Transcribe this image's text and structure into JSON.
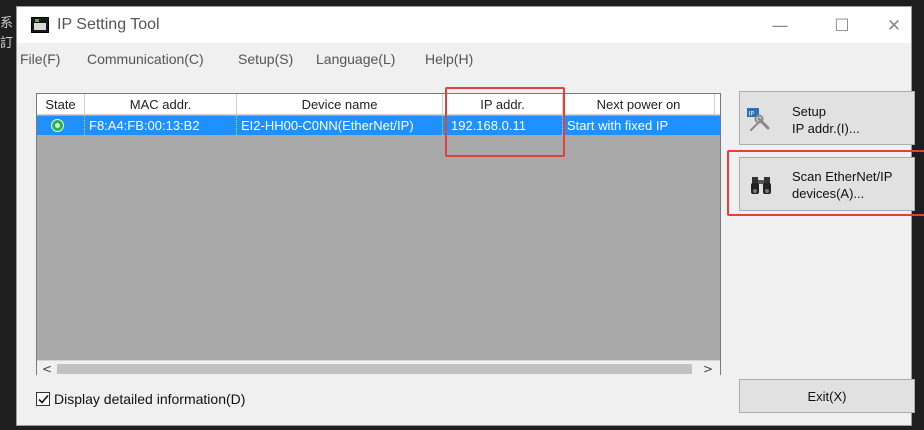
{
  "desktop": {
    "glyph_top": "系",
    "glyph_bottom": "訂"
  },
  "window": {
    "title": "IP Setting Tool",
    "controls": {
      "minimize": "—",
      "maximize": "☐",
      "close": "✕"
    }
  },
  "menu": [
    "File(F)",
    "Communication(C)",
    "Setup(S)",
    "Language(L)",
    "Help(H)"
  ],
  "device_list": {
    "columns": [
      "State",
      "MAC addr.",
      "Device name",
      "IP addr.",
      "Next power on"
    ],
    "rows": [
      {
        "state": "online",
        "mac": "F8:A4:FB:00:13:B2",
        "device_name": "EI2-HH00-C0NN(EtherNet/IP)",
        "ip": "192.168.0.11",
        "next_power_on": "Start with fixed IP"
      }
    ],
    "scroll": {
      "left": "<",
      "right": ">"
    }
  },
  "buttons": {
    "setup_line1": "Setup",
    "setup_line2": "IP addr.(I)...",
    "scan_line1": "Scan EtherNet/IP",
    "scan_line2": "devices(A)...",
    "exit": "Exit(X)"
  },
  "detail_checkbox": {
    "label": "Display detailed information(D)",
    "checked": true
  },
  "colors": {
    "selection": "#1e90ff",
    "highlight": "#e0413a",
    "list_bg": "#a9a9a9"
  }
}
